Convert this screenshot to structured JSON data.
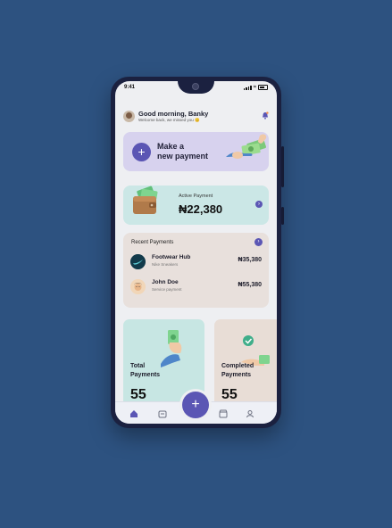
{
  "status_bar": {
    "time": "9:41"
  },
  "header": {
    "greeting": "Good morning, Banky",
    "subtitle": "Welcome back, we missed you 😊"
  },
  "new_payment_card": {
    "title_line1": "Make a",
    "title_line2": "new payment",
    "icon": "plus-icon"
  },
  "active_payment": {
    "label": "Active Payment",
    "amount": "₦22,380"
  },
  "recent_payments": {
    "title": "Recent Payments",
    "items": [
      {
        "name": "Footwear Hub",
        "subtitle": "Nike Sneakers",
        "amount": "₦35,380"
      },
      {
        "name": "John Doe",
        "subtitle": "Service payment",
        "amount": "₦55,380"
      }
    ]
  },
  "tiles": [
    {
      "label_line1": "Total",
      "label_line2": "Payments",
      "value": "55"
    },
    {
      "label_line1": "Completed",
      "label_line2": "Payments",
      "value": "55"
    }
  ],
  "nav": {
    "items": [
      "home-icon",
      "wallet-icon",
      "plus-icon",
      "store-icon",
      "profile-icon"
    ]
  },
  "colors": {
    "background": "#2d5280",
    "accent": "#5b56b4",
    "new_payment_bg": "#d7d2ee",
    "active_payment_bg": "#cbe7e6"
  }
}
